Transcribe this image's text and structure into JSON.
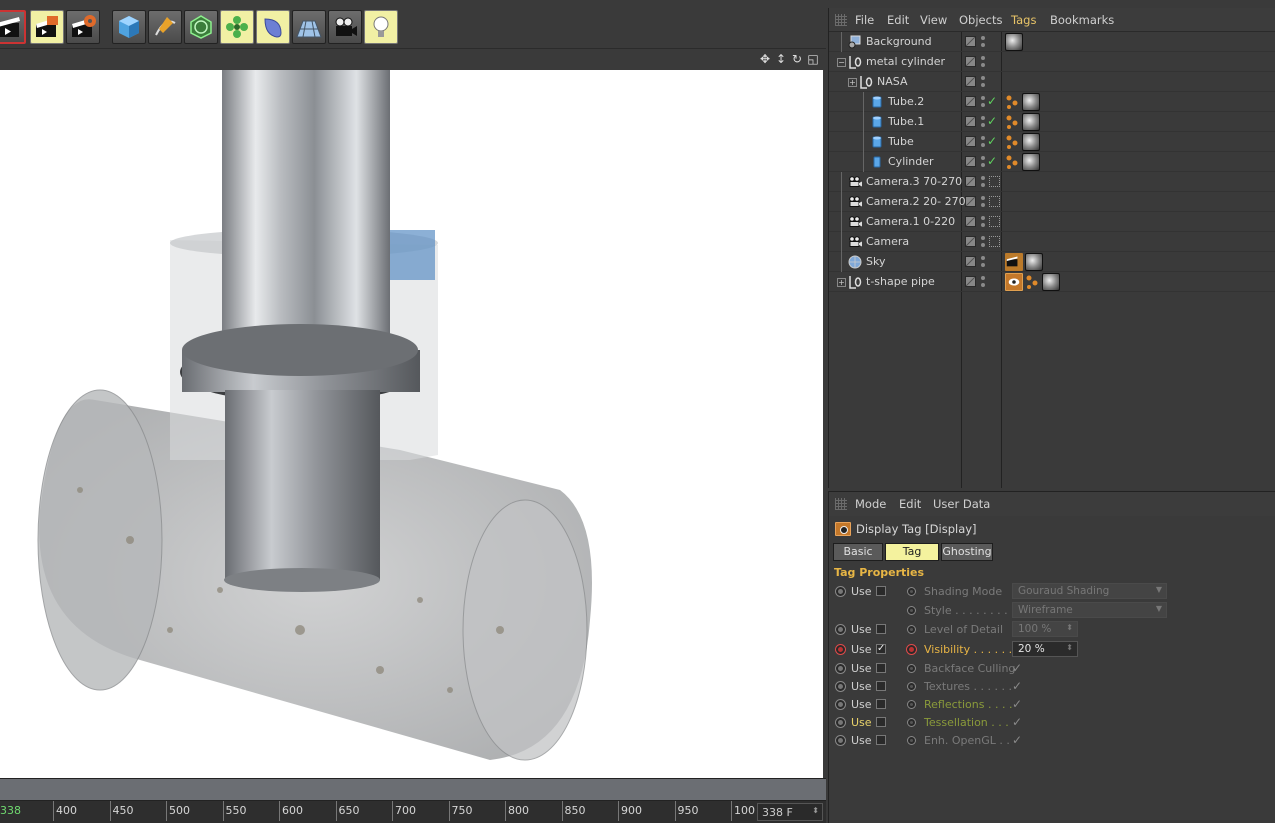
{
  "objects_menu": [
    "File",
    "Edit",
    "View",
    "Objects",
    "Tags",
    "Bookmarks"
  ],
  "objects_menu_active": "Tags",
  "objects": [
    {
      "name": "Background",
      "indent": 0,
      "icon": "background-icon",
      "tags": [
        "material"
      ]
    },
    {
      "name": "metal cylinder",
      "indent": 0,
      "icon": "null-icon",
      "expander": "−"
    },
    {
      "name": "NASA",
      "indent": 1,
      "icon": "null-icon",
      "expander": "+"
    },
    {
      "name": "Tube.2",
      "indent": 2,
      "icon": "tube-icon",
      "checked": true,
      "tags": [
        "texture-dots",
        "material"
      ]
    },
    {
      "name": "Tube.1",
      "indent": 2,
      "icon": "tube-icon",
      "checked": true,
      "tags": [
        "texture-dots",
        "material"
      ]
    },
    {
      "name": "Tube",
      "indent": 2,
      "icon": "tube-icon",
      "checked": true,
      "tags": [
        "texture-dots",
        "material"
      ]
    },
    {
      "name": "Cylinder",
      "indent": 2,
      "icon": "cylinder-icon",
      "checked": true,
      "tags": [
        "texture-dots",
        "material"
      ]
    },
    {
      "name": "Camera.3 70-270",
      "indent": 0,
      "icon": "camera-icon",
      "camtag": true
    },
    {
      "name": "Camera.2 20- 270",
      "indent": 0,
      "icon": "camera-icon",
      "camtag": true
    },
    {
      "name": "Camera.1 0-220",
      "indent": 0,
      "icon": "camera-icon",
      "camtag": true
    },
    {
      "name": "Camera",
      "indent": 0,
      "icon": "camera-icon",
      "camtag": true
    },
    {
      "name": "Sky",
      "indent": 0,
      "icon": "sky-icon",
      "tags": [
        "compositing",
        "material"
      ]
    },
    {
      "name": "t-shape pipe",
      "indent": 0,
      "icon": "null-icon",
      "expander": "+",
      "tags": [
        "display",
        "texture-dots",
        "material"
      ]
    }
  ],
  "attr_menu": [
    "Mode",
    "Edit",
    "User Data"
  ],
  "attr_title": "Display Tag [Display]",
  "attr_tabs": [
    "Basic",
    "Tag",
    "Ghosting"
  ],
  "attr_tab_selected": "Tag",
  "section_title": "Tag Properties",
  "use_label": "Use",
  "properties": [
    {
      "use": true,
      "label": "Shading Mode",
      "field": "Gouraud Shading",
      "kind": "dropdown"
    },
    {
      "use": false,
      "label": "Style . . . . . . . . .",
      "field": "Wireframe",
      "kind": "dropdown"
    },
    {
      "use": true,
      "label": "Level of Detail",
      "field": "100 %",
      "kind": "spinner"
    },
    {
      "use": true,
      "label": "Visibility . . . . . .",
      "field": "20 %",
      "kind": "spinner",
      "active": true,
      "checked": true
    },
    {
      "use": true,
      "label": "Backface Culling",
      "kind": "check"
    },
    {
      "use": true,
      "label": "Textures . . . . . .",
      "kind": "check"
    },
    {
      "use": true,
      "label": "Reflections . . . .",
      "kind": "check",
      "green": true
    },
    {
      "use": true,
      "label": "Tessellation . . .",
      "kind": "check",
      "green": true,
      "yellow_use": true
    },
    {
      "use": true,
      "label": "Enh. OpenGL . .",
      "kind": "check"
    }
  ],
  "timeline": {
    "current": "338",
    "ticks": [
      "400",
      "450",
      "500",
      "550",
      "600",
      "650",
      "700",
      "750",
      "800",
      "850",
      "900",
      "950",
      "100"
    ],
    "frame_field": "338 F"
  }
}
